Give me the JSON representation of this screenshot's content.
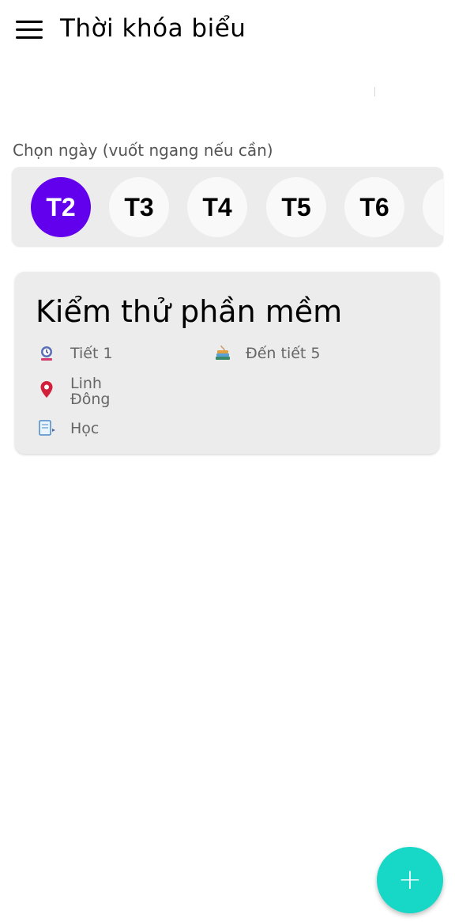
{
  "appbar": {
    "title": "Thời khóa biểu",
    "menu_icon": "hamburger-menu-icon"
  },
  "day_selector": {
    "caption": "Chọn ngày (vuốt ngang nếu cần)",
    "selected": "T2",
    "days": [
      "T2",
      "T3",
      "T4",
      "T5",
      "T6"
    ],
    "active_color": "#6200ee"
  },
  "schedule": [
    {
      "subject": "Kiểm thử phần mềm",
      "start_period": "Tiết 1",
      "end_period": "Đến tiết 5",
      "location": "Linh Đông",
      "type": "Học"
    }
  ],
  "fab": {
    "icon": "plus-icon",
    "color": "#17d8c6"
  }
}
